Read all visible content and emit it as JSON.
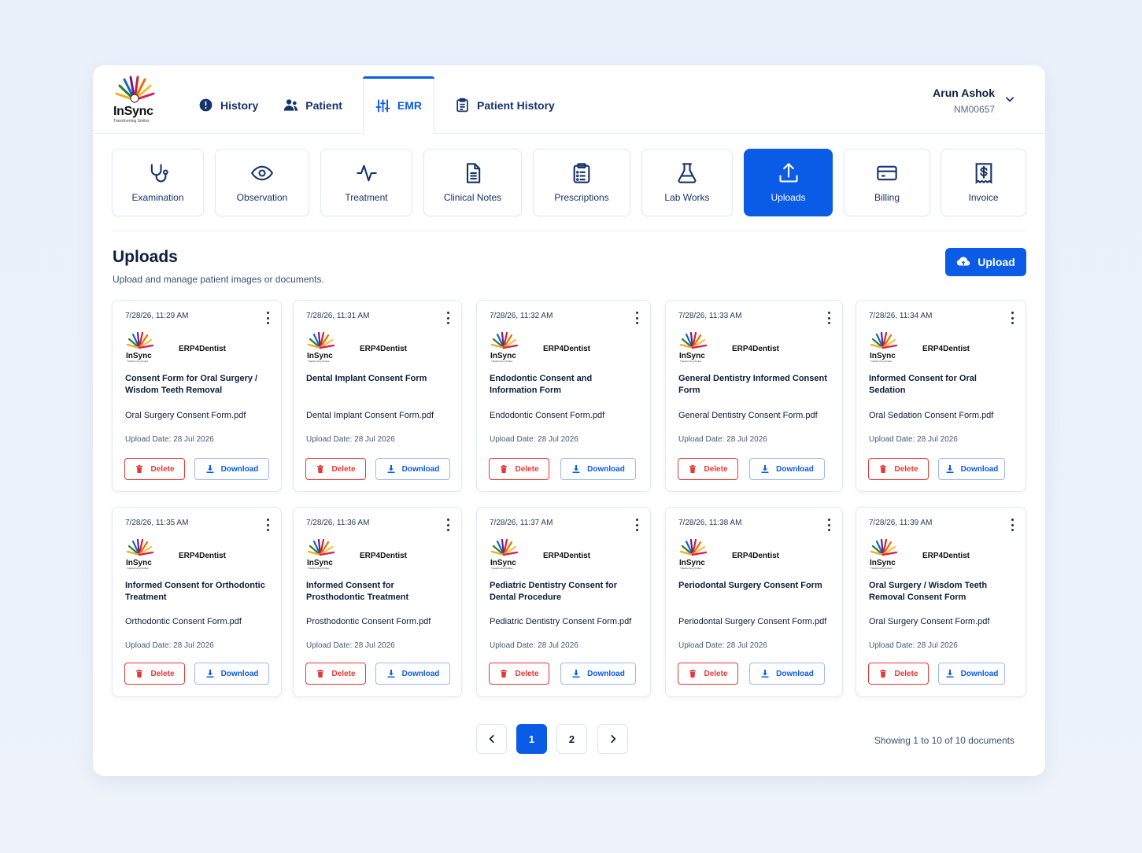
{
  "brand": {
    "name": "InSync",
    "tagline": "Transforming Smiles"
  },
  "nav": [
    {
      "label": "History",
      "icon": "alert-circle-icon"
    },
    {
      "label": "Patient",
      "icon": "users-icon"
    },
    {
      "label": "EMR",
      "icon": "sliders-icon",
      "active": true
    },
    {
      "label": "Patient History",
      "icon": "clipboard-icon"
    }
  ],
  "user": {
    "name": "Arun Ashok",
    "id": "NM00657"
  },
  "modules": [
    {
      "label": "Examination",
      "icon": "stethoscope-icon"
    },
    {
      "label": "Observation",
      "icon": "eye-icon"
    },
    {
      "label": "Treatment",
      "icon": "activity-icon"
    },
    {
      "label": "Clinical Notes",
      "icon": "document-icon"
    },
    {
      "label": "Prescriptions",
      "icon": "clipboard-list-icon"
    },
    {
      "label": "Lab Works",
      "icon": "flask-icon"
    },
    {
      "label": "Uploads",
      "icon": "upload-icon",
      "active": true
    },
    {
      "label": "Billing",
      "icon": "credit-card-icon"
    },
    {
      "label": "Invoice",
      "icon": "receipt-dollar-icon"
    }
  ],
  "section": {
    "title": "Uploads",
    "subtitle": "Upload and manage patient images or documents.",
    "upload_label": "Upload"
  },
  "card_labels": {
    "brand": "ERP4Dentist",
    "delete": "Delete",
    "download": "Download"
  },
  "documents": [
    {
      "date": "7/28/26, 11:29 AM",
      "title": "Consent Form for Oral Surgery / Wisdom Teeth Removal",
      "file": "Oral Surgery Consent Form.pdf",
      "upload": "Upload Date: 28 Jul 2026"
    },
    {
      "date": "7/28/26, 11:31 AM",
      "title": "Dental Implant Consent Form",
      "file": "Dental Implant Consent Form.pdf",
      "upload": "Upload Date: 28 Jul 2026"
    },
    {
      "date": "7/28/26, 11:32 AM",
      "title": "Endodontic Consent and Information Form",
      "file": "Endodontic Consent Form.pdf",
      "upload": "Upload Date: 28 Jul 2026"
    },
    {
      "date": "7/28/26, 11:33 AM",
      "title": "General Dentistry Informed Consent Form",
      "file": "General Dentistry Consent Form.pdf",
      "upload": "Upload Date: 28 Jul 2026"
    },
    {
      "date": "7/28/26, 11:34 AM",
      "title": "Informed Consent for Oral Sedation",
      "file": "Oral Sedation Consent Form.pdf",
      "upload": "Upload Date: 28 Jul 2026"
    },
    {
      "date": "7/28/26, 11:35 AM",
      "title": "Informed Consent for Orthodontic Treatment",
      "file": "Orthodontic Consent Form.pdf",
      "upload": "Upload Date: 28 Jul 2026"
    },
    {
      "date": "7/28/26, 11:36 AM",
      "title": "Informed Consent for Prosthodontic Treatment",
      "file": "Prosthodontic Consent Form.pdf",
      "upload": "Upload Date: 28 Jul 2026"
    },
    {
      "date": "7/28/26, 11:37 AM",
      "title": "Pediatric Dentistry Consent for Dental Procedure",
      "file": "Pediatric Dentistry Consent Form.pdf",
      "upload": "Upload Date: 28 Jul 2026"
    },
    {
      "date": "7/28/26, 11:38 AM",
      "title": "Periodontal Surgery Consent Form",
      "file": "Periodontal Surgery Consent Form.pdf",
      "upload": "Upload Date: 28 Jul 2026"
    },
    {
      "date": "7/28/26, 11:39 AM",
      "title": "Oral Surgery / Wisdom Teeth Removal Consent Form",
      "file": "Oral Surgery Consent Form.pdf",
      "upload": "Upload Date: 28 Jul 2026"
    }
  ],
  "pagination": {
    "pages": [
      "1",
      "2"
    ],
    "current": "1",
    "showing": "Showing 1 to 10 of 10 documents"
  },
  "colors": {
    "primary": "#0a5ce6",
    "danger": "#e53935",
    "text": "#0f1e3d"
  }
}
